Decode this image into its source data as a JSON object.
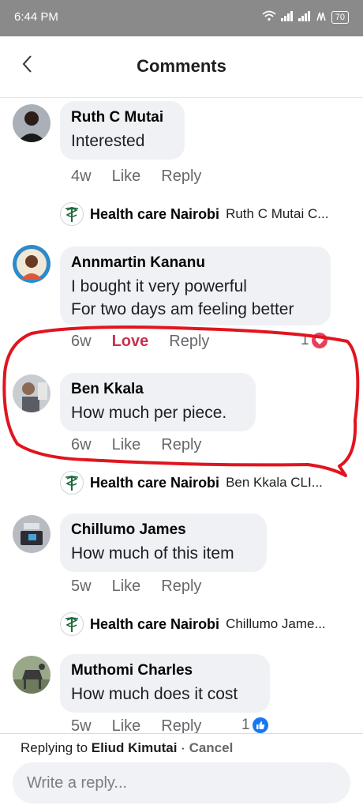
{
  "status_bar": {
    "time": "6:44 PM",
    "battery": "70"
  },
  "header": {
    "title": "Comments"
  },
  "comments": [
    {
      "author": "Ruth C Mutai",
      "lines": [
        "Interested"
      ],
      "time": "4w",
      "reaction_action": "Like",
      "reply": "Reply"
    },
    {
      "author": "Annmartin Kananu",
      "lines": [
        "I bought it very powerful",
        "For two days am feeling better"
      ],
      "time": "6w",
      "reaction_action": "Love",
      "reply": "Reply",
      "reaction_count": "1"
    },
    {
      "author": "Ben Kkala",
      "lines": [
        "How much per piece."
      ],
      "time": "6w",
      "reaction_action": "Like",
      "reply": "Reply"
    },
    {
      "author": "Chillumo James",
      "lines": [
        "How much of this item"
      ],
      "time": "5w",
      "reaction_action": "Like",
      "reply": "Reply"
    },
    {
      "author": "Muthomi Charles",
      "lines": [
        "How much does it cost"
      ],
      "time": "5w",
      "reaction_action": "Like",
      "reply": "Reply",
      "reaction_count": "1"
    }
  ],
  "page_replies": [
    {
      "page": "Health care Nairobi",
      "preview": "Ruth C Mutai C..."
    },
    {
      "page": "Health care Nairobi",
      "preview": "Ben Kkala CLI..."
    },
    {
      "page": "Health care Nairobi",
      "preview": "Chillumo Jame..."
    }
  ],
  "footer": {
    "replying_prefix": "Replying to",
    "replying_to": "Eliud Kimutai",
    "separator": "·",
    "cancel": "Cancel",
    "placeholder": "Write a reply..."
  },
  "colors": {
    "love": "#c9314e",
    "like_blue": "#1877f2",
    "annotation_red": "#e0151e",
    "status_bar": "#8a8a8a"
  }
}
